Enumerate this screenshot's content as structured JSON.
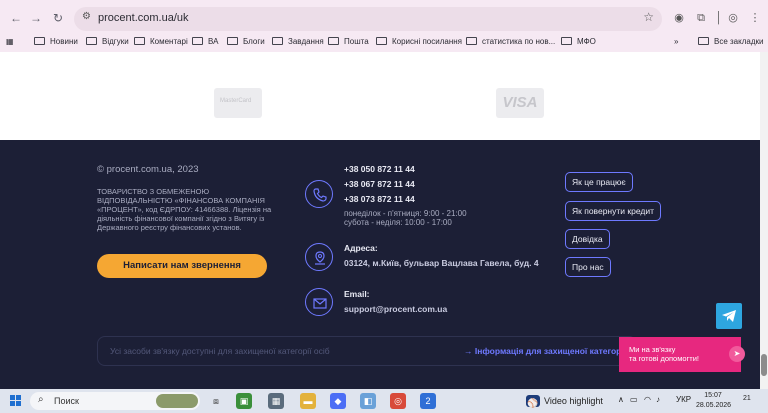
{
  "browser": {
    "url": "procent.com.ua/uk",
    "bookmarks": [
      {
        "label": "Новини"
      },
      {
        "label": "Відгуки"
      },
      {
        "label": "Коментарі"
      },
      {
        "label": "ВА"
      },
      {
        "label": "Блоги"
      },
      {
        "label": "Завдання"
      },
      {
        "label": "Пошта"
      },
      {
        "label": "Корисні посилання"
      },
      {
        "label": "статистика по нов..."
      },
      {
        "label": "МФО"
      }
    ],
    "more_chevron": "»",
    "all_bookmarks": "Все закладки"
  },
  "payments": {
    "mastercard_text": "MasterCard",
    "visa_text": "VISA"
  },
  "footer": {
    "copyright": "© procent.com.ua, 2023",
    "company_info": "ТОВАРИСТВО З ОБМЕЖЕНОЮ ВІДПОВІДАЛЬНІСТЮ «ФІНАНСОВА КОМПАНІЯ «ПРОЦЕНТ», код ЄДРПОУ: 41466388. Ліцензія на діяльність фінансової компанії згідно з Витягу із Державного реєстру фінансових установ.",
    "cta_button": "Написати нам звернення",
    "phones": [
      "+38 050 872 11 44",
      "+38 067 872 11 44",
      "+38 073 872 11 44"
    ],
    "hours_weekdays": "понеділок - п'ятниця: 9:00 - 21:00",
    "hours_saturday": "субота - неділя: 10:00 - 17:00",
    "address_label": "Адреса:",
    "address_value": "03124, м.Київ, бульвар Вацлава Гавела, буд. 4",
    "email_label": "Email:",
    "email_value": "support@procent.com.ua",
    "links": [
      {
        "label": "Як це працює"
      },
      {
        "label": "Як повернути кредит"
      },
      {
        "label": "Довідка"
      },
      {
        "label": "Про нас"
      }
    ],
    "notice_text": "Усі засоби зв'язку доступні для захищеної категорії осіб",
    "notice_link": "→ Інформація для захищеної категорії"
  },
  "chat": {
    "line1": "Ми на зв'язку",
    "line2": "та готові допомогти!"
  },
  "taskbar": {
    "search_placeholder": "Поиск",
    "video_highlight": "Video highlight",
    "language": "УКР",
    "time": "15:07",
    "date": "28.05.2026",
    "notif_count": "21",
    "badge_count": "2"
  },
  "colors": {
    "footer_bg": "#1c1f36",
    "accent_orange": "#f5a733",
    "accent_blue": "#6e79ff",
    "chat_pink": "#e7287f",
    "telegram": "#2ea6e0"
  }
}
